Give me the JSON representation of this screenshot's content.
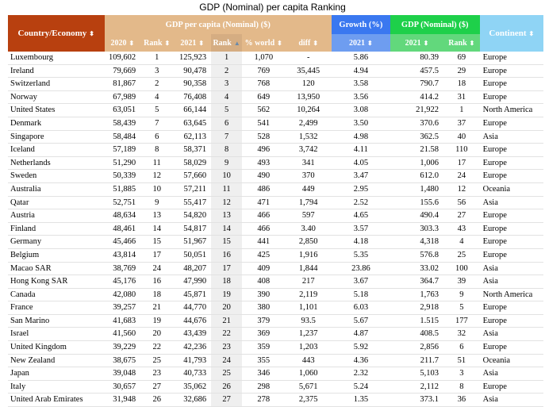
{
  "title": "GDP (Nominal) per capita Ranking",
  "headers": {
    "country": "Country/Economy",
    "gdp_pc": "GDP per capita (Nominal) ($)",
    "growth": "Growth (%)",
    "gdp_nominal": "GDP (Nominal) ($)",
    "continent": "Continent",
    "sub": [
      "2020",
      "Rank",
      "2021",
      "Rank",
      "% world",
      "diff",
      "2021",
      "2021",
      "Rank"
    ]
  },
  "sort_icon": "⬍",
  "sort_icon_active": "▲",
  "colors": {
    "country_header": "#b8400f",
    "gdp_pc_header": "#e3b98a",
    "growth_header": "#3a78f0",
    "gdp_nominal_header": "#1ed04a",
    "continent_header": "#8fd4f5"
  },
  "rows": [
    {
      "country": "Luxembourg",
      "gdp2020": "109,602",
      "rank2020": "1",
      "gdp2021": "125,923",
      "rank2021": "1",
      "pct_world": "1,070",
      "diff": "-",
      "growth": "5.86",
      "gdpn": "80.39",
      "gdpn_rank": "69",
      "continent": "Europe"
    },
    {
      "country": "Ireland",
      "gdp2020": "79,669",
      "rank2020": "3",
      "gdp2021": "90,478",
      "rank2021": "2",
      "pct_world": "769",
      "diff": "35,445",
      "growth": "4.94",
      "gdpn": "457.5",
      "gdpn_rank": "29",
      "continent": "Europe"
    },
    {
      "country": "Switzerland",
      "gdp2020": "81,867",
      "rank2020": "2",
      "gdp2021": "90,358",
      "rank2021": "3",
      "pct_world": "768",
      "diff": "120",
      "growth": "3.58",
      "gdpn": "790.7",
      "gdpn_rank": "18",
      "continent": "Europe"
    },
    {
      "country": "Norway",
      "gdp2020": "67,989",
      "rank2020": "4",
      "gdp2021": "76,408",
      "rank2021": "4",
      "pct_world": "649",
      "diff": "13,950",
      "growth": "3.56",
      "gdpn": "414.2",
      "gdpn_rank": "31",
      "continent": "Europe"
    },
    {
      "country": "United States",
      "gdp2020": "63,051",
      "rank2020": "5",
      "gdp2021": "66,144",
      "rank2021": "5",
      "pct_world": "562",
      "diff": "10,264",
      "growth": "3.08",
      "gdpn": "21,922",
      "gdpn_rank": "1",
      "continent": "North America"
    },
    {
      "country": "Denmark",
      "gdp2020": "58,439",
      "rank2020": "7",
      "gdp2021": "63,645",
      "rank2021": "6",
      "pct_world": "541",
      "diff": "2,499",
      "growth": "3.50",
      "gdpn": "370.6",
      "gdpn_rank": "37",
      "continent": "Europe"
    },
    {
      "country": "Singapore",
      "gdp2020": "58,484",
      "rank2020": "6",
      "gdp2021": "62,113",
      "rank2021": "7",
      "pct_world": "528",
      "diff": "1,532",
      "growth": "4.98",
      "gdpn": "362.5",
      "gdpn_rank": "40",
      "continent": "Asia"
    },
    {
      "country": "Iceland",
      "gdp2020": "57,189",
      "rank2020": "8",
      "gdp2021": "58,371",
      "rank2021": "8",
      "pct_world": "496",
      "diff": "3,742",
      "growth": "4.11",
      "gdpn": "21.58",
      "gdpn_rank": "110",
      "continent": "Europe"
    },
    {
      "country": "Netherlands",
      "gdp2020": "51,290",
      "rank2020": "11",
      "gdp2021": "58,029",
      "rank2021": "9",
      "pct_world": "493",
      "diff": "341",
      "growth": "4.05",
      "gdpn": "1,006",
      "gdpn_rank": "17",
      "continent": "Europe"
    },
    {
      "country": "Sweden",
      "gdp2020": "50,339",
      "rank2020": "12",
      "gdp2021": "57,660",
      "rank2021": "10",
      "pct_world": "490",
      "diff": "370",
      "growth": "3.47",
      "gdpn": "612.0",
      "gdpn_rank": "24",
      "continent": "Europe"
    },
    {
      "country": "Australia",
      "gdp2020": "51,885",
      "rank2020": "10",
      "gdp2021": "57,211",
      "rank2021": "11",
      "pct_world": "486",
      "diff": "449",
      "growth": "2.95",
      "gdpn": "1,480",
      "gdpn_rank": "12",
      "continent": "Oceania"
    },
    {
      "country": "Qatar",
      "gdp2020": "52,751",
      "rank2020": "9",
      "gdp2021": "55,417",
      "rank2021": "12",
      "pct_world": "471",
      "diff": "1,794",
      "growth": "2.52",
      "gdpn": "155.6",
      "gdpn_rank": "56",
      "continent": "Asia"
    },
    {
      "country": "Austria",
      "gdp2020": "48,634",
      "rank2020": "13",
      "gdp2021": "54,820",
      "rank2021": "13",
      "pct_world": "466",
      "diff": "597",
      "growth": "4.65",
      "gdpn": "490.4",
      "gdpn_rank": "27",
      "continent": "Europe"
    },
    {
      "country": "Finland",
      "gdp2020": "48,461",
      "rank2020": "14",
      "gdp2021": "54,817",
      "rank2021": "14",
      "pct_world": "466",
      "diff": "3.40",
      "growth": "3.57",
      "gdpn": "303.3",
      "gdpn_rank": "43",
      "continent": "Europe"
    },
    {
      "country": "Germany",
      "gdp2020": "45,466",
      "rank2020": "15",
      "gdp2021": "51,967",
      "rank2021": "15",
      "pct_world": "441",
      "diff": "2,850",
      "growth": "4.18",
      "gdpn": "4,318",
      "gdpn_rank": "4",
      "continent": "Europe"
    },
    {
      "country": "Belgium",
      "gdp2020": "43,814",
      "rank2020": "17",
      "gdp2021": "50,051",
      "rank2021": "16",
      "pct_world": "425",
      "diff": "1,916",
      "growth": "5.35",
      "gdpn": "576.8",
      "gdpn_rank": "25",
      "continent": "Europe"
    },
    {
      "country": "Macao SAR",
      "gdp2020": "38,769",
      "rank2020": "24",
      "gdp2021": "48,207",
      "rank2021": "17",
      "pct_world": "409",
      "diff": "1,844",
      "growth": "23.86",
      "gdpn": "33.02",
      "gdpn_rank": "100",
      "continent": "Asia"
    },
    {
      "country": "Hong Kong SAR",
      "gdp2020": "45,176",
      "rank2020": "16",
      "gdp2021": "47,990",
      "rank2021": "18",
      "pct_world": "408",
      "diff": "217",
      "growth": "3.67",
      "gdpn": "364.7",
      "gdpn_rank": "39",
      "continent": "Asia"
    },
    {
      "country": "Canada",
      "gdp2020": "42,080",
      "rank2020": "18",
      "gdp2021": "45,871",
      "rank2021": "19",
      "pct_world": "390",
      "diff": "2,119",
      "growth": "5.18",
      "gdpn": "1,763",
      "gdpn_rank": "9",
      "continent": "North America"
    },
    {
      "country": "France",
      "gdp2020": "39,257",
      "rank2020": "21",
      "gdp2021": "44,770",
      "rank2021": "20",
      "pct_world": "380",
      "diff": "1,101",
      "growth": "6.03",
      "gdpn": "2,918",
      "gdpn_rank": "5",
      "continent": "Europe"
    },
    {
      "country": "San Marino",
      "gdp2020": "41,683",
      "rank2020": "19",
      "gdp2021": "44,676",
      "rank2021": "21",
      "pct_world": "379",
      "diff": "93.5",
      "growth": "5.67",
      "gdpn": "1.515",
      "gdpn_rank": "177",
      "continent": "Europe"
    },
    {
      "country": "Israel",
      "gdp2020": "41,560",
      "rank2020": "20",
      "gdp2021": "43,439",
      "rank2021": "22",
      "pct_world": "369",
      "diff": "1,237",
      "growth": "4.87",
      "gdpn": "408.5",
      "gdpn_rank": "32",
      "continent": "Asia"
    },
    {
      "country": "United Kingdom",
      "gdp2020": "39,229",
      "rank2020": "22",
      "gdp2021": "42,236",
      "rank2021": "23",
      "pct_world": "359",
      "diff": "1,203",
      "growth": "5.92",
      "gdpn": "2,856",
      "gdpn_rank": "6",
      "continent": "Europe"
    },
    {
      "country": "New Zealand",
      "gdp2020": "38,675",
      "rank2020": "25",
      "gdp2021": "41,793",
      "rank2021": "24",
      "pct_world": "355",
      "diff": "443",
      "growth": "4.36",
      "gdpn": "211.7",
      "gdpn_rank": "51",
      "continent": "Oceania"
    },
    {
      "country": "Japan",
      "gdp2020": "39,048",
      "rank2020": "23",
      "gdp2021": "40,733",
      "rank2021": "25",
      "pct_world": "346",
      "diff": "1,060",
      "growth": "2.32",
      "gdpn": "5,103",
      "gdpn_rank": "3",
      "continent": "Asia"
    },
    {
      "country": "Italy",
      "gdp2020": "30,657",
      "rank2020": "27",
      "gdp2021": "35,062",
      "rank2021": "26",
      "pct_world": "298",
      "diff": "5,671",
      "growth": "5.24",
      "gdpn": "2,112",
      "gdpn_rank": "8",
      "continent": "Europe"
    },
    {
      "country": "United Arab Emirates",
      "gdp2020": "31,948",
      "rank2020": "26",
      "gdp2021": "32,686",
      "rank2021": "27",
      "pct_world": "278",
      "diff": "2,375",
      "growth": "1.35",
      "gdpn": "373.1",
      "gdpn_rank": "36",
      "continent": "Asia"
    }
  ]
}
